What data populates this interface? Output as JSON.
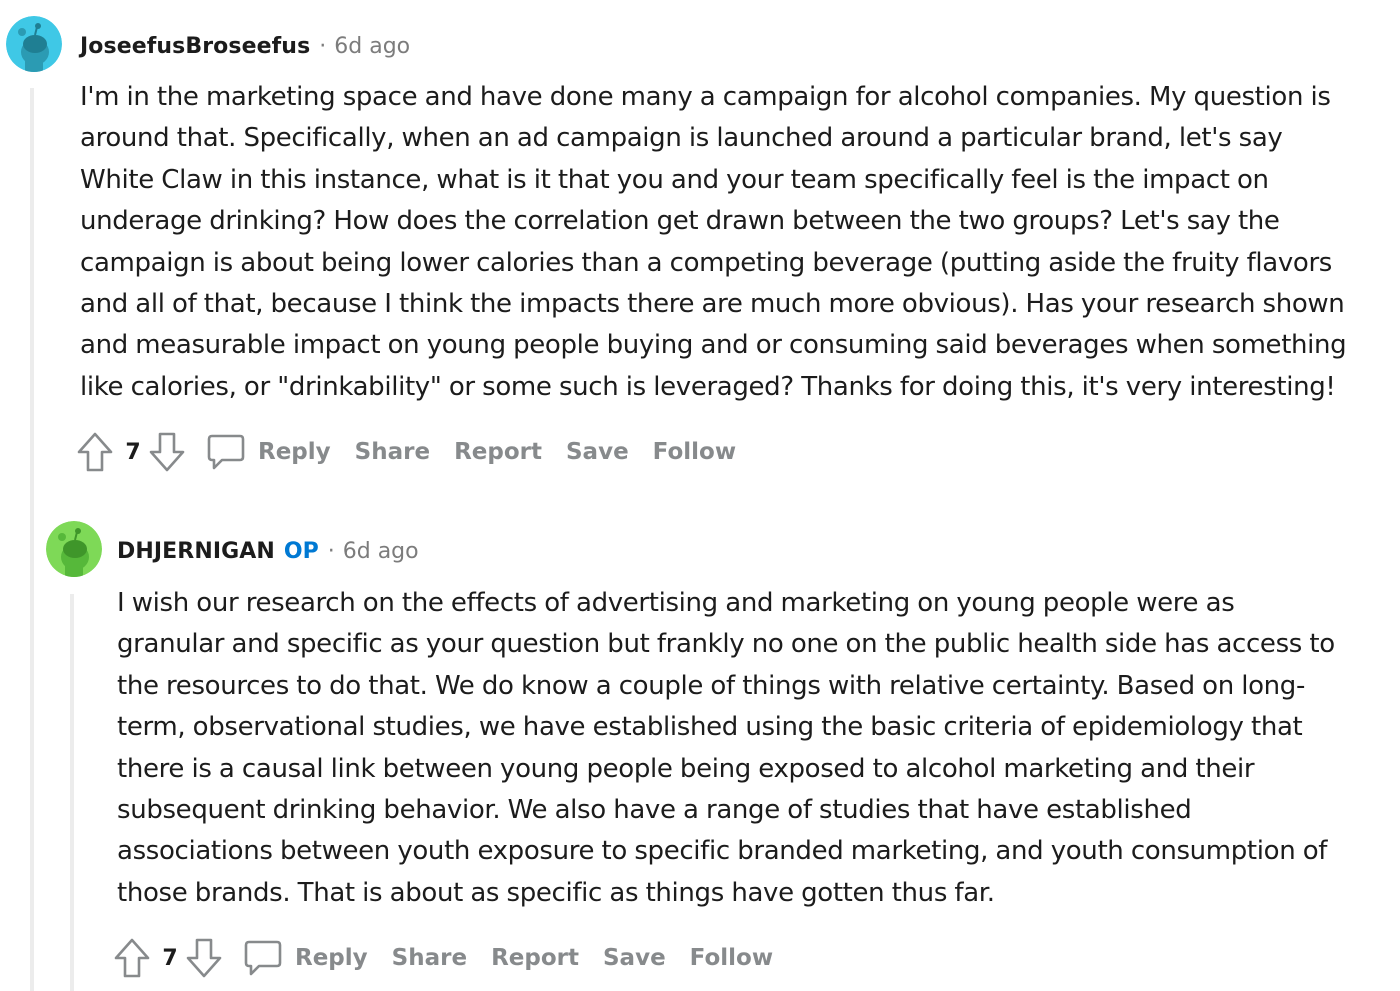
{
  "comments": [
    {
      "username": "JoseefusBroseefus",
      "op_badge": "",
      "separator": "·",
      "time": "6d ago",
      "avatar_color": "#3fc8e6",
      "body": "I'm in the marketing space and have done many a campaign for alcohol companies. My question is\naround that. Specifically, when an ad campaign is launched around a particular brand, let's say\nWhite Claw in this instance, what is it that you and your team specifically feel is the impact on\nunderage drinking? How does the correlation get drawn between the two groups? Let's say the\ncampaign is about being lower calories than a competing beverage (putting aside the fruity flavors\nand all of that, because I think the impacts there are much more obvious). Has your research shown\nand measurable impact on young people buying and or consuming said beverages when something\nlike calories, or \"drinkability\" or some such is leveraged? Thanks for doing this, it's very interesting!",
      "votes": "7",
      "actions": {
        "reply": "Reply",
        "share": "Share",
        "report": "Report",
        "save": "Save",
        "follow": "Follow"
      }
    },
    {
      "username": "DHJERNIGAN",
      "op_badge": "OP",
      "separator": "·",
      "time": "6d ago",
      "avatar_color": "#7ed957",
      "body": "I wish our research on the effects of advertising and marketing on young people were as\ngranular and specific as your question but frankly no one on the public health side has access to\nthe resources to do that. We do know a couple of things with relative certainty. Based on long-\nterm, observational studies, we have established using the basic criteria of epidemiology that\nthere is a causal link between young people being exposed to alcohol marketing and their\nsubsequent drinking behavior. We also have a range of studies that have established\nassociations between youth exposure to specific branded marketing, and youth consumption of\nthose brands. That is about as specific as things have gotten thus far.",
      "votes": "7",
      "actions": {
        "reply": "Reply",
        "share": "Share",
        "report": "Report",
        "save": "Save",
        "follow": "Follow"
      }
    }
  ],
  "colors": {
    "action_text": "#878a8c",
    "op_badge": "#0079d3",
    "thread_line": "#ececec"
  },
  "icons": [
    "upvote-icon",
    "downvote-icon",
    "comment-icon",
    "snoo-avatar-icon"
  ]
}
